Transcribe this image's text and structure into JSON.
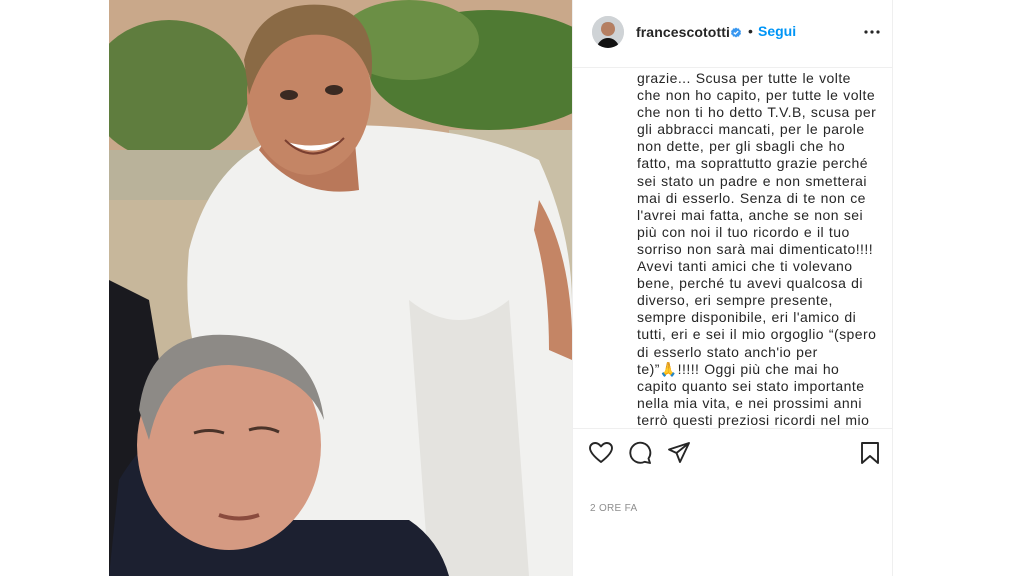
{
  "post": {
    "photo_alt": "",
    "username": "francescototti",
    "separator": "•",
    "follow_label": "Segui",
    "caption": "grazie... Scusa per tutte le volte che non ho capito, per tutte le volte che non ti ho detto T.V.B, scusa per gli abbracci mancati, per le parole non dette, per gli sbagli che ho fatto, ma soprattutto grazie perché sei stato un padre e non smetterai mai di esserlo. Senza di te non ce l'avrei mai fatta, anche se non sei più con noi il tuo ricordo e il tuo sorriso non sarà mai dimenticato!!!! Avevi tanti amici che ti volevano bene, perché tu avevi qualcosa di diverso, eri sempre presente, sempre disponibile, eri l'amico di tutti, eri e sei il mio orgoglio “(spero di esserlo stato anch'io per te)”🙏!!!!! Oggi più che mai ho capito quanto sei stato importante nella mia vita, e nei prossimi anni terrò questi preziosi ricordi nel mio cuore. Ciao",
    "timestamp": "2 ORE FA"
  },
  "icons": {
    "verified": "verified-badge-icon",
    "more": "more-options-icon",
    "like": "heart-icon",
    "comment": "comment-icon",
    "share": "share-icon",
    "save": "bookmark-icon"
  },
  "colors": {
    "accent": "#0095f6",
    "text": "#262626",
    "muted": "#8e8e8e",
    "border": "#efefef"
  }
}
